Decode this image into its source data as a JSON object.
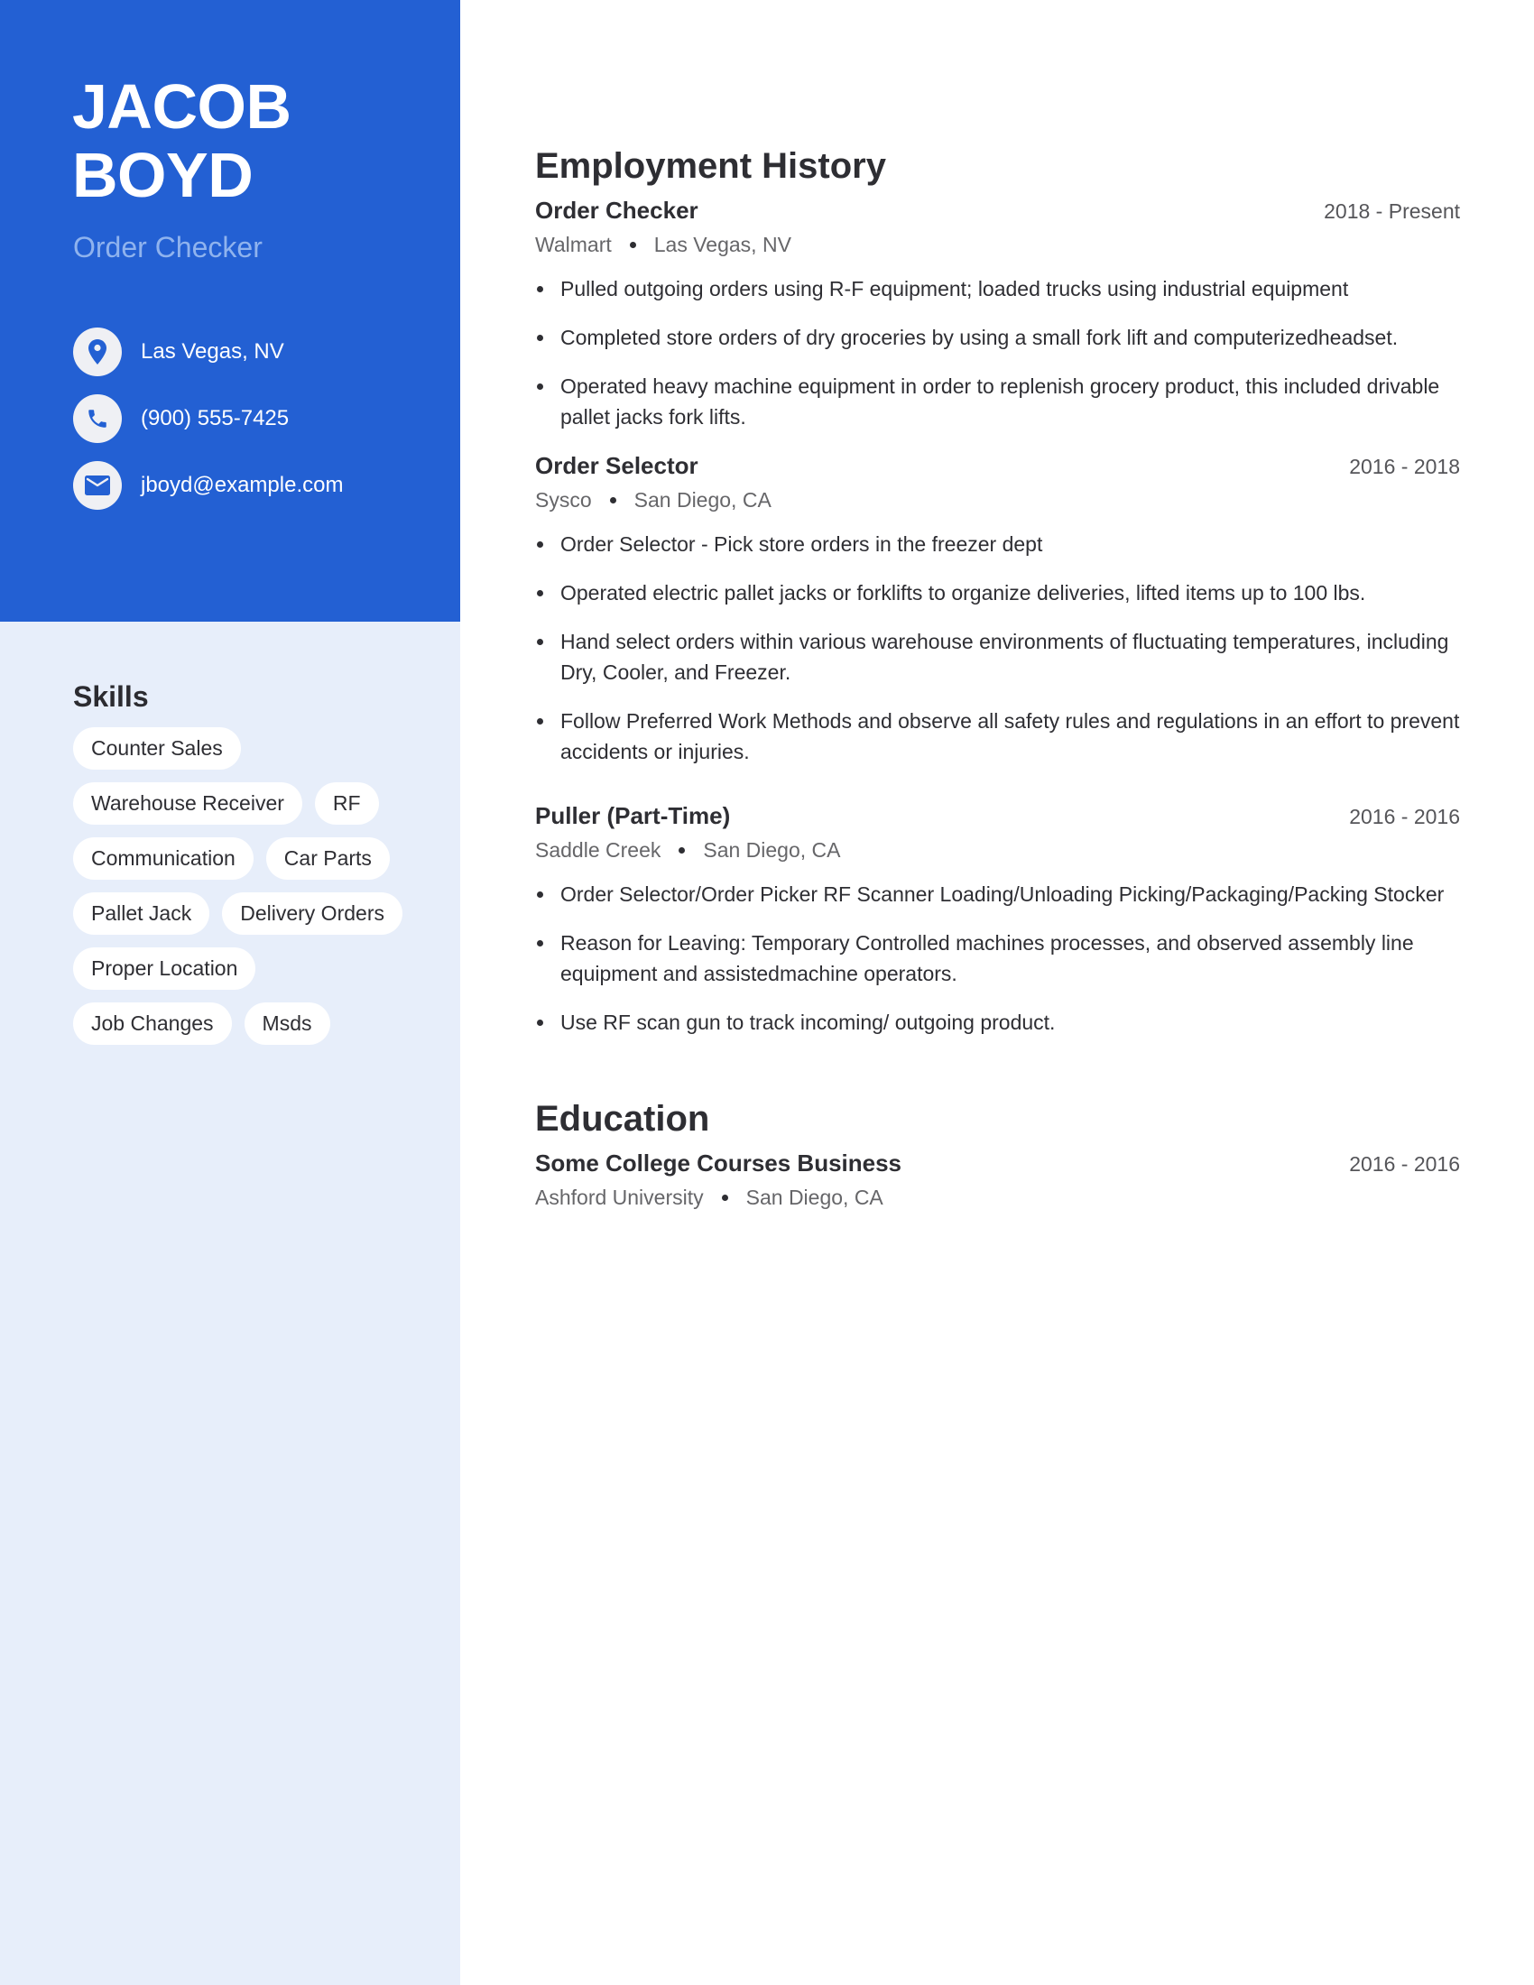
{
  "colors": {
    "accent": "#2360d3",
    "sidebar_light": "#e7eefa",
    "subtitle": "#8fb3ee",
    "text": "#2e2e33",
    "muted": "#555559"
  },
  "profile": {
    "first_name": "JACOB",
    "last_name": "BOYD",
    "title": "Order Checker"
  },
  "contacts": [
    {
      "icon": "location-pin-icon",
      "text": "Las Vegas, NV"
    },
    {
      "icon": "phone-icon",
      "text": "(900) 555-7425"
    },
    {
      "icon": "envelope-icon",
      "text": "jboyd@example.com"
    }
  ],
  "skills": {
    "heading": "Skills",
    "items": [
      "Counter Sales",
      "Warehouse Receiver",
      "RF",
      "Communication",
      "Car Parts",
      "Pallet Jack",
      "Delivery Orders",
      "Proper Location",
      "Job Changes",
      "Msds"
    ]
  },
  "employment": {
    "heading": "Employment History",
    "jobs": [
      {
        "title": "Order Checker",
        "dates": "2018 - Present",
        "company": "Walmart",
        "location": "Las Vegas, NV",
        "bullets": [
          "Pulled outgoing orders using R-F equipment; loaded trucks using industrial equipment",
          "Completed store orders of dry groceries by using a small fork lift and computerizedheadset.",
          "Operated heavy machine equipment in order to replenish grocery product, this included drivable pallet jacks fork lifts."
        ]
      },
      {
        "title": "Order Selector",
        "dates": "2016 - 2018",
        "company": "Sysco",
        "location": "San Diego, CA",
        "bullets": [
          "Order Selector - Pick store orders in the freezer dept",
          "Operated electric pallet jacks or forklifts to organize deliveries, lifted items up to 100 lbs.",
          "Hand select orders within various warehouse environments of fluctuating temperatures, including Dry, Cooler, and Freezer.",
          "Follow Preferred Work Methods and observe all safety rules and regulations in an effort to prevent accidents or injuries."
        ]
      },
      {
        "title": "Puller (Part-Time)",
        "dates": "2016 - 2016",
        "company": "Saddle Creek",
        "location": "San Diego, CA",
        "bullets": [
          "Order Selector/Order Picker RF Scanner Loading/Unloading Picking/Packaging/Packing Stocker",
          "Reason for Leaving: Temporary Controlled machines processes, and observed assembly line equipment and assistedmachine operators.",
          "Use RF scan gun to track incoming/ outgoing product."
        ]
      }
    ]
  },
  "education": {
    "heading": "Education",
    "entries": [
      {
        "degree": "Some College Courses Business",
        "dates": "2016 - 2016",
        "school": "Ashford University",
        "location": "San Diego, CA"
      }
    ]
  }
}
